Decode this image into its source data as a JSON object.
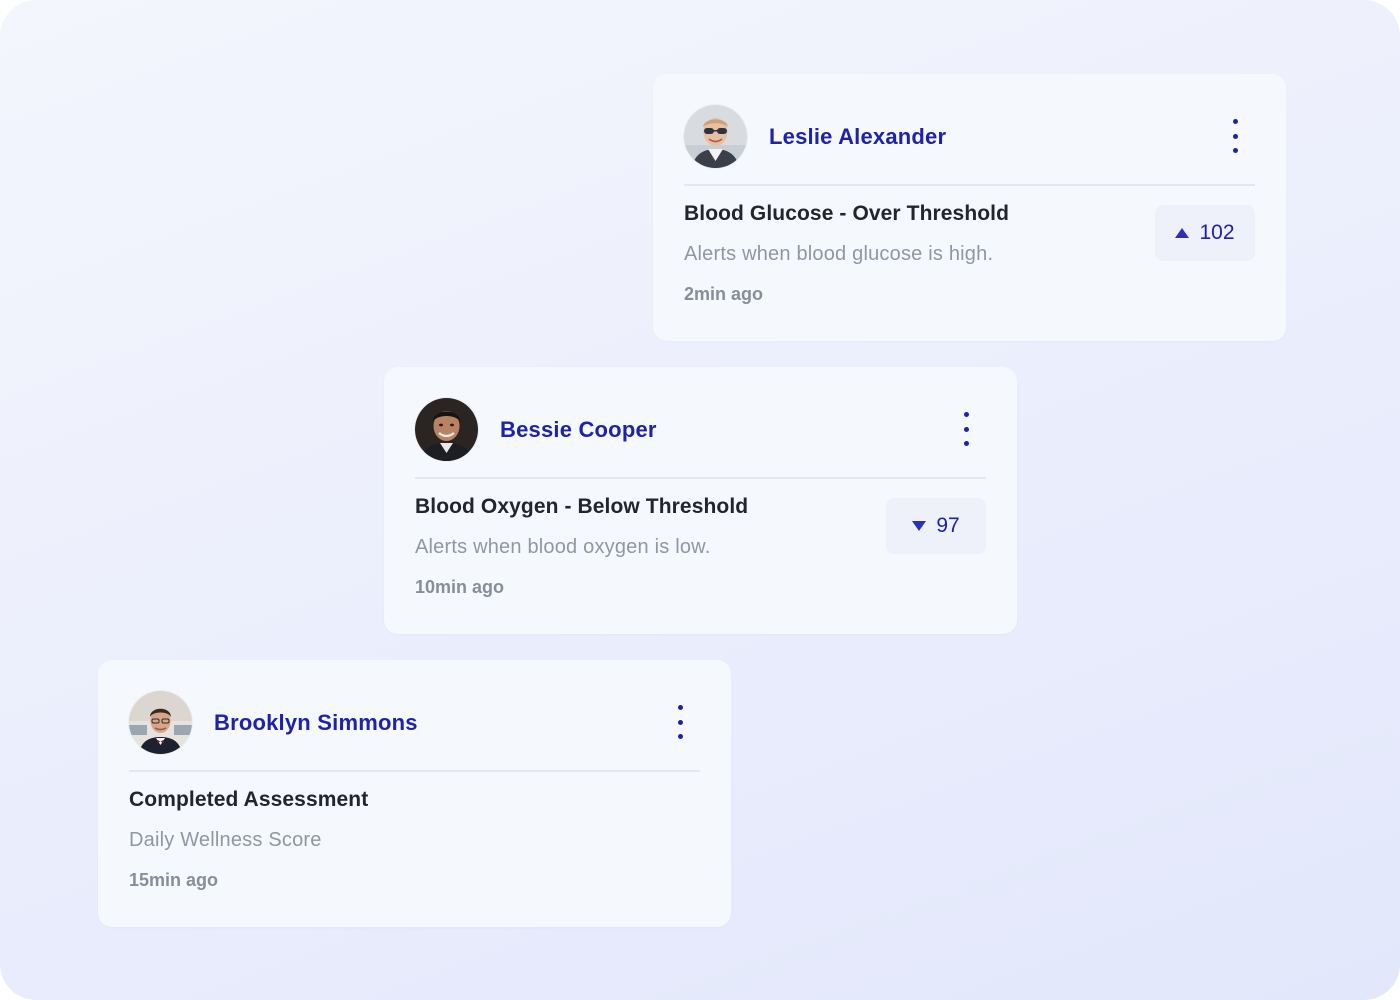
{
  "cards": [
    {
      "user_name": "Leslie Alexander",
      "alert_title": "Blood Glucose - Over Threshold",
      "alert_description": "Alerts when blood glucose is high.",
      "time_ago": "2min ago",
      "value": "102",
      "trend_icon": "triangle-up-icon"
    },
    {
      "user_name": "Bessie Cooper",
      "alert_title": "Blood Oxygen - Below Threshold",
      "alert_description": "Alerts when blood oxygen is low.",
      "time_ago": "10min ago",
      "value": "97",
      "trend_icon": "triangle-down-icon"
    },
    {
      "user_name": "Brooklyn Simmons",
      "alert_title": "Completed Assessment",
      "alert_description": "Daily Wellness Score",
      "time_ago": "15min ago"
    }
  ],
  "colors": {
    "accent": "#1f22a6",
    "title_text": "#23252e",
    "muted_text": "#9096a3",
    "card_background": "#f5f8fd",
    "badge_background": "#eef1fa"
  }
}
